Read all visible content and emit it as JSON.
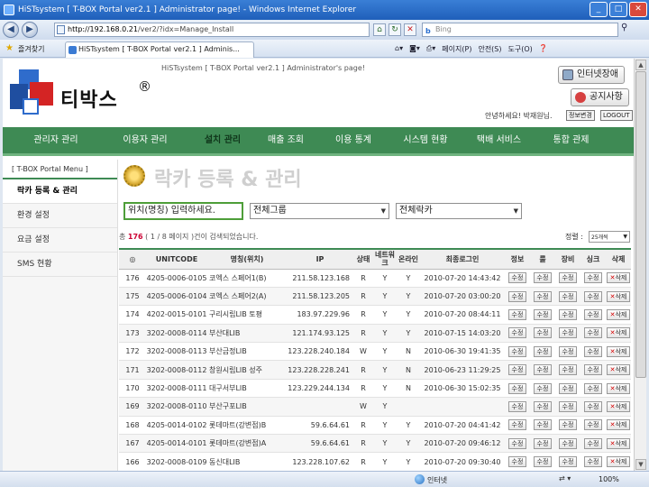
{
  "browser": {
    "title": "HiSTsystem [ T-BOX Portal ver2.1 ] Administrator page! - Windows Internet Explorer",
    "url_host": "http://192.168.0.21",
    "url_path": "/ver2/?idx=Manage_Install",
    "search_placeholder": "Bing",
    "favorites_label": "즐겨찾기",
    "tab_title": "HiSTsystem [ T-BOX Portal ver2.1 ] Adminis...",
    "tools": [
      "페이지(P)",
      "안전(S)",
      "도구(O)"
    ],
    "status_zone": "인터넷",
    "zoom": "100%"
  },
  "site": {
    "brand": "티박스",
    "reg_mark": "®",
    "portal_title": "HiSTsystem [ T-BOX Portal ver2.1 ] Administrator's page!",
    "btn_error": "인터넷장애",
    "btn_notice": "공지사항",
    "welcome": "안녕하세요! 박재원님.",
    "btn_myinfo": "정보변경",
    "btn_logout": "LOGOUT"
  },
  "menu": {
    "items": [
      "관리자 관리",
      "이용자 관리",
      "설치 관리",
      "매출 조회",
      "이용 통계",
      "시스템 현황",
      "택배 서비스",
      "통합 관제"
    ]
  },
  "left_menu": {
    "header": "[ T-BOX Portal Menu ]",
    "items": [
      "락카 등록 & 관리",
      "환경 설정",
      "요금 설정",
      "SMS 현황"
    ]
  },
  "page": {
    "title": "락카 등록 & 관리",
    "location_placeholder": "위치(명칭) 입력하세요.",
    "group_select": "전체그룹",
    "locker_select": "전체락카",
    "count_prefix": "총",
    "count_total": "176",
    "count_suffix": "( 1 / 8 페이지 )건이 검색되었습니다.",
    "sort_label": "정렬 :",
    "sort_value": "25개씩"
  },
  "table": {
    "headers": [
      "◎",
      "UNITCODE",
      "명칭(위치)",
      "IP",
      "상태",
      "네트워크",
      "온라인",
      "최종로그인",
      "정보",
      "룰",
      "장비",
      "싱크",
      "삭제"
    ],
    "btn_edit": "수정",
    "btn_delete": "삭제",
    "rows": [
      [
        "176",
        "4205-0006-0105",
        "코엑스 스페어1(B)",
        "211.58.123.168",
        "R",
        "Y",
        "Y",
        "2010-07-20 14:43:42"
      ],
      [
        "175",
        "4205-0006-0104",
        "코엑스 스페어2(A)",
        "211.58.123.205",
        "R",
        "Y",
        "Y",
        "2010-07-20 03:00:20"
      ],
      [
        "174",
        "4202-0015-0101",
        "구리시립LIB 토평",
        "183.97.229.96",
        "R",
        "Y",
        "Y",
        "2010-07-20 08:44:11"
      ],
      [
        "173",
        "3202-0008-0114",
        "부산대LIB",
        "121.174.93.125",
        "R",
        "Y",
        "Y",
        "2010-07-15 14:03:20"
      ],
      [
        "172",
        "3202-0008-0113",
        "부산금정LIB",
        "123.228.240.184",
        "W",
        "Y",
        "N",
        "2010-06-30 19:41:35"
      ],
      [
        "171",
        "3202-0008-0112",
        "창원시립LIB 성주",
        "123.228.228.241",
        "R",
        "Y",
        "N",
        "2010-06-23 11:29:25"
      ],
      [
        "170",
        "3202-0008-0111",
        "대구서부LIB",
        "123.229.244.134",
        "R",
        "Y",
        "N",
        "2010-06-30 15:02:35"
      ],
      [
        "169",
        "3202-0008-0110",
        "부산구포LIB",
        "",
        "W",
        "Y",
        "",
        ""
      ],
      [
        "168",
        "4205-0014-0102",
        "롯데마트(강변점)B",
        "59.6.64.61",
        "R",
        "Y",
        "Y",
        "2010-07-20 04:41:42"
      ],
      [
        "167",
        "4205-0014-0101",
        "롯데마트(강변점)A",
        "59.6.64.61",
        "R",
        "Y",
        "Y",
        "2010-07-20 09:46:12"
      ],
      [
        "166",
        "3202-0008-0109",
        "동신대LIB",
        "123.228.107.62",
        "R",
        "Y",
        "Y",
        "2010-07-20 09:30:40"
      ]
    ]
  },
  "colors": {
    "menu_green": "#3e8a54",
    "delete_red": "#d40000",
    "count_red": "#cc0033"
  }
}
